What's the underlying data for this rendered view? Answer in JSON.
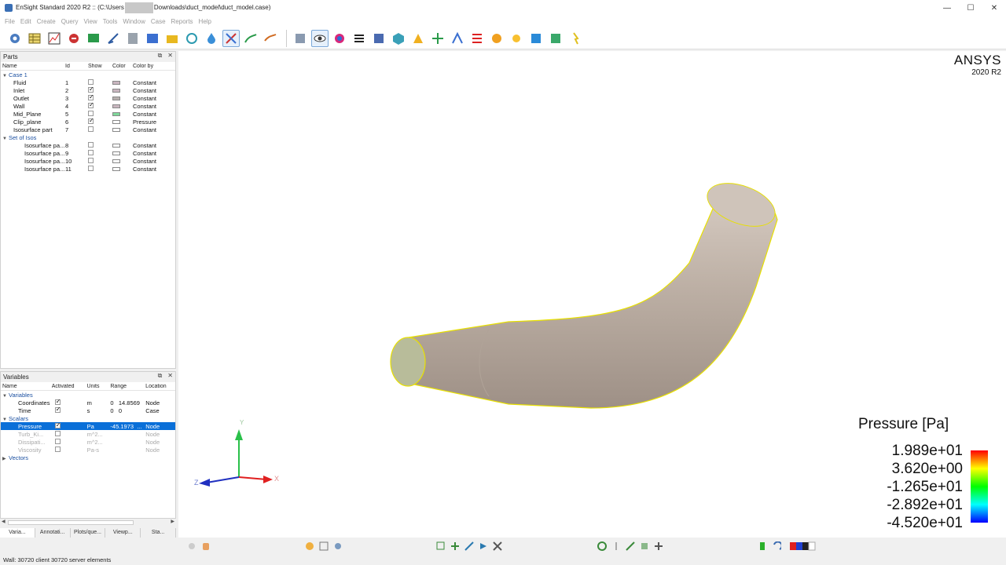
{
  "window": {
    "title_prefix": "EnSight Standard 2020 R2 :: (C:\\Users",
    "title_suffix": "Downloads\\duct_model\\duct_model.case)",
    "min": "—",
    "max": "☐",
    "close": "✕"
  },
  "menu": [
    "File",
    "Edit",
    "Create",
    "Query",
    "View",
    "Tools",
    "Window",
    "Case",
    "Reports",
    "Help"
  ],
  "parts_panel": {
    "title": "Parts",
    "columns": {
      "name": "Name",
      "id": "Id",
      "show": "Show",
      "color": "Color",
      "color_by": "Color by"
    },
    "rows": [
      {
        "name": "Case 1",
        "id": "",
        "show": null,
        "color": "",
        "color_by": "",
        "level": 0,
        "group": true
      },
      {
        "name": "Fluid",
        "id": "1",
        "show": false,
        "color": "#c9b6c0",
        "color_by": "Constant",
        "level": 1
      },
      {
        "name": "Inlet",
        "id": "2",
        "show": true,
        "color": "#c9b6c0",
        "color_by": "Constant",
        "level": 1
      },
      {
        "name": "Outlet",
        "id": "3",
        "show": true,
        "color": "#b7b0ae",
        "color_by": "Constant",
        "level": 1
      },
      {
        "name": "Wall",
        "id": "4",
        "show": true,
        "color": "#c9b6c0",
        "color_by": "Constant",
        "level": 1
      },
      {
        "name": "Mid_Plane",
        "id": "5",
        "show": false,
        "color": "#7fd89a",
        "color_by": "Constant",
        "level": 1
      },
      {
        "name": "Clip_plane",
        "id": "6",
        "show": true,
        "color": "#ffffff",
        "color_by": "Pressure",
        "level": 1
      },
      {
        "name": "Isosurface part",
        "id": "7",
        "show": false,
        "color": "#ffffff",
        "color_by": "Constant",
        "level": 1
      },
      {
        "name": "Set of Isos",
        "id": "",
        "show": null,
        "color": "",
        "color_by": "",
        "level": 0,
        "group": true
      },
      {
        "name": "Isosurface pa...",
        "id": "8",
        "show": false,
        "color": "#ffffff",
        "color_by": "Constant",
        "level": 2
      },
      {
        "name": "Isosurface pa...",
        "id": "9",
        "show": false,
        "color": "#ffffff",
        "color_by": "Constant",
        "level": 2
      },
      {
        "name": "Isosurface pa...",
        "id": "10",
        "show": false,
        "color": "#ffffff",
        "color_by": "Constant",
        "level": 2
      },
      {
        "name": "Isosurface pa...",
        "id": "11",
        "show": false,
        "color": "#ffffff",
        "color_by": "Constant",
        "level": 2
      }
    ]
  },
  "variables_panel": {
    "title": "Variables",
    "columns": {
      "name": "Name",
      "activated": "Activated",
      "units": "Units",
      "range": "Range",
      "location": "Location"
    },
    "rows": [
      {
        "name": "Variables",
        "activated": null,
        "units": "",
        "range": "",
        "location": "",
        "level": 0,
        "group": true
      },
      {
        "name": "Coordinates",
        "activated": true,
        "units": "m",
        "range": "0   14.8569",
        "location": "Node",
        "level": 2
      },
      {
        "name": "Time",
        "activated": true,
        "units": "s",
        "range": "0   0",
        "location": "Case",
        "level": 2
      },
      {
        "name": "Scalars",
        "activated": null,
        "units": "",
        "range": "",
        "location": "",
        "level": 0,
        "group": true
      },
      {
        "name": "Pressure",
        "activated": true,
        "units": "Pa",
        "range": "-45.1973  ...",
        "location": "Node",
        "level": 2,
        "selected": true
      },
      {
        "name": "Turb_Ki...",
        "activated": false,
        "units": "m^2...",
        "range": "",
        "location": "Node",
        "level": 2,
        "dim": true
      },
      {
        "name": "Dissipati...",
        "activated": false,
        "units": "m^2...",
        "range": "",
        "location": "Node",
        "level": 2,
        "dim": true
      },
      {
        "name": "Viscosity",
        "activated": false,
        "units": "Pa-s",
        "range": "",
        "location": "Node",
        "level": 2,
        "dim": true
      },
      {
        "name": "Vectors",
        "activated": null,
        "units": "",
        "range": "",
        "location": "",
        "level": 0,
        "group": true
      }
    ]
  },
  "tabs": [
    "Varia...",
    "Annotati...",
    "Plots/que...",
    "Viewp...",
    "Sta..."
  ],
  "viewport": {
    "brand": "ANSYS",
    "version": "2020 R2",
    "axis_y": "Y",
    "axis_x": "X",
    "axis_z": "Z",
    "legend_title": "Pressure [Pa]",
    "legend_values": [
      "1.989e+01",
      "3.620e+00",
      "-1.265e+01",
      "-2.892e+01",
      "-4.520e+01"
    ]
  },
  "status": "Wall: 30720 client 30720 server elements"
}
